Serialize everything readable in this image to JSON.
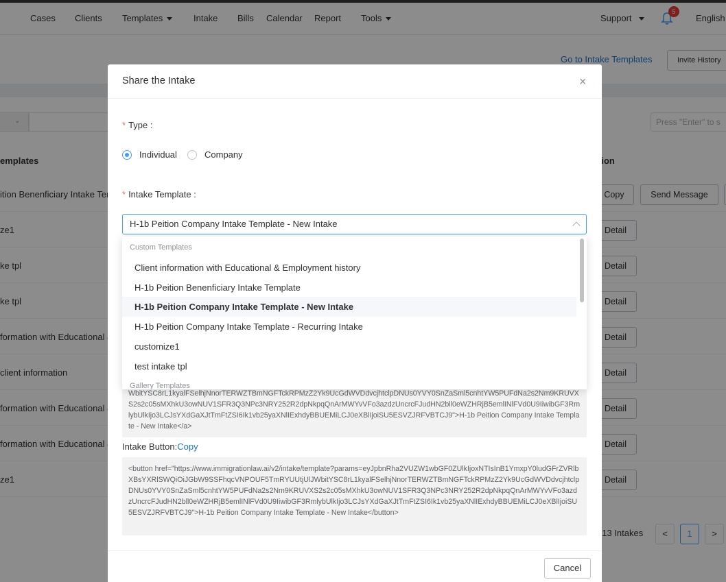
{
  "nav": {
    "items": [
      "Cases",
      "Clients",
      "Templates",
      "Intake",
      "Bills",
      "Calendar",
      "Report",
      "Tools"
    ],
    "support": "Support",
    "notifications": "5",
    "language": "English"
  },
  "page": {
    "go_intake_templates": "Go to Intake Templates",
    "invite_history": "Invite History",
    "search_placeholder": "Press \"Enter\" to s",
    "col_templates": "emplates",
    "col_action": "tion",
    "rows": [
      {
        "name": "ition Benenficiary Intake Ter",
        "buttons": [
          "Copy",
          "Send Message"
        ]
      },
      {
        "name": "ze1",
        "buttons": [
          "Detail"
        ]
      },
      {
        "name": "ke tpl",
        "buttons": [
          "Detail"
        ]
      },
      {
        "name": "ke tpl",
        "buttons": [
          "Detail"
        ]
      },
      {
        "name": "formation with Educational &",
        "buttons": [
          "Detail"
        ]
      },
      {
        "name": "client information",
        "buttons": [
          "Detail"
        ]
      },
      {
        "name": "formation with Educational &",
        "buttons": [
          "Detail"
        ]
      },
      {
        "name": "formation with Educational &",
        "buttons": [
          "Detail"
        ]
      },
      {
        "name": "ze1",
        "buttons": [
          "Detail"
        ]
      }
    ],
    "pager_total": "/ 13 Intakes",
    "pager_prev": "<",
    "pager_page": "1",
    "pager_next": ">"
  },
  "modal": {
    "title": "Share the Intake",
    "type_label": "Type",
    "type_options": [
      "Individual",
      "Company"
    ],
    "type_selected": "Individual",
    "template_label": "Intake Template",
    "template_value": "H-1b Peition Company Intake Template - New Intake",
    "link_code": "WbitYSC8rL1kyalFSelhjNnorTERWZTBmNGFTckRPMzZ2Yk9UcGdWVDdvcjhtclpDNUs0YVY0SnZaSml5cnhtYW5PUFdNa2s2Nm9KRUVXS2s2c05sMXhkU3owNUV1SFR3Q3NPc3NRY252R2dpNkpqQnArMWYvVFo3azdzUncrcFJudHN2bll0eWZHRjB5emlINlFVd0U9IiwibGF3RmlybUlkIjo3LCJsYXdGaXJtTmFtZSI6Ik1vb25yaXNlIExhdyBBUEMiLCJ0eXBlIjoiSU5ESVZJRFVBTCJ9\">H-1b Peition Company Intake Template - New Intake</a>",
    "button_label": "Intake Button:",
    "copy_label": "Copy",
    "button_code": "<button href=\"https://www.immigrationlaw.ai/v2/intake/template?params=eyJpbnRha2VUZW1wbGF0ZUlkIjoxNTIsInB1YmxpY0ludGFrZVRlbXBsYXRlSWQiOiJGbW9SSFhqcVNPOUF5TmRYUUtjUlJWbitYSC8rL1kyalFSelhjNnorTERWZTBmNGFTckRPMzZ2Yk9UcGdWVDdvcjhtclpDNUs0YVY0SnZaSml5cnhtYW5PUFdNa2s2Nm9KRUVXS2s2c05sMXhkU3owNUV1SFR3Q3NPc3NRY252R2dpNkpqQnArMWYvVFo3azdzUncrcFJudHN2bll0eWZHRjB5emlINlFVd0U9IiwibGF3RmlybUlkIjo3LCJsYXdGaXJtTmFtZSI6Ik1vb25yaXNlIExhdyBBUEMiLCJ0eXBlIjoiSU5ESVZJRFVBTCJ9\">H-1b Peition Company Intake Template - New Intake</button>",
    "cancel": "Cancel"
  },
  "dropdown": {
    "group_custom": "Custom Templates",
    "items": [
      "Client information with Educational & Employment history",
      "H-1b Peition Benenficiary Intake Template",
      "H-1b Peition Company Intake Template - New Intake",
      "H-1b Peition Company Intake Template - Recurring Intake",
      "customize1",
      "test intake tpl"
    ],
    "selected_index": 2,
    "group_gallery": "Gallery Templates"
  }
}
